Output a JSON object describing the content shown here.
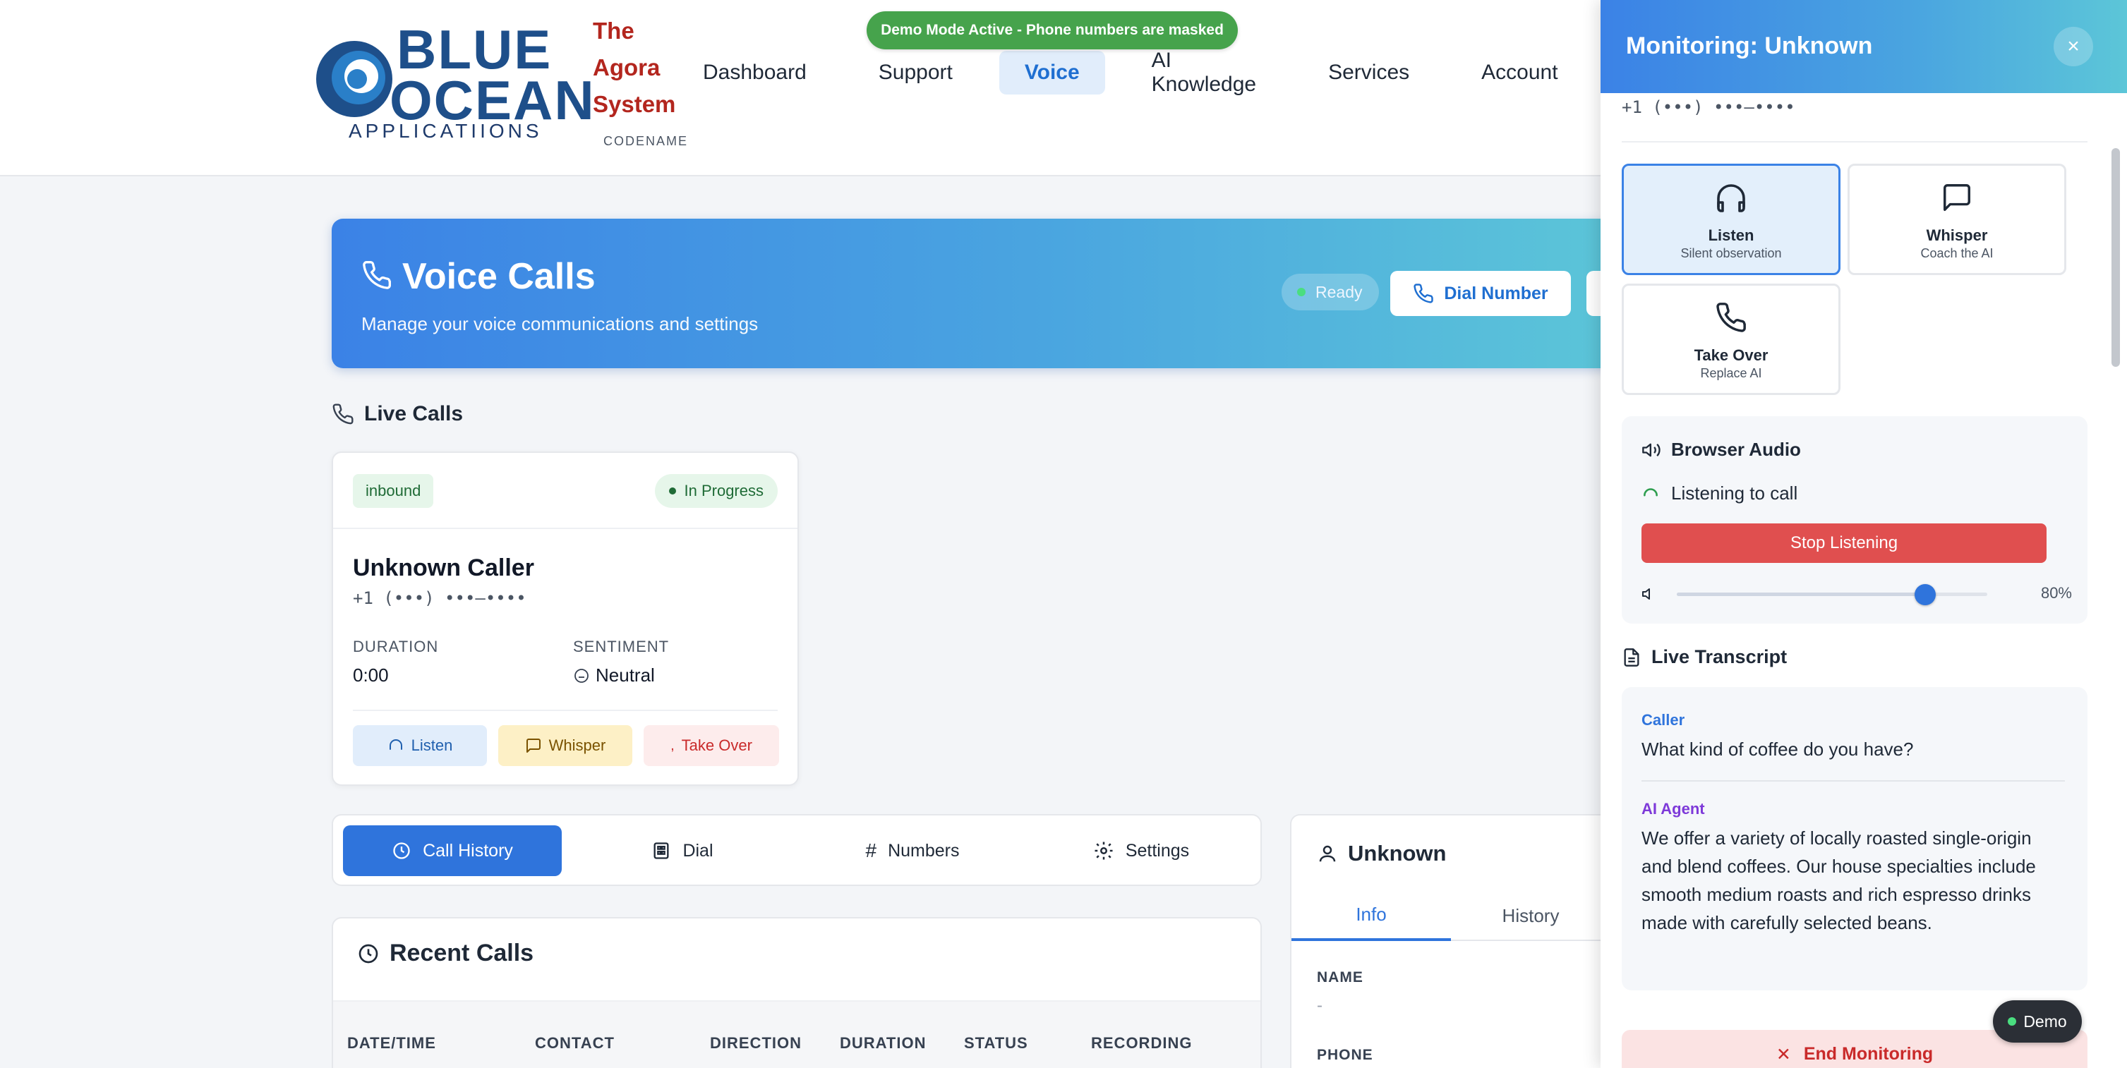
{
  "demo_banner": "Demo Mode Active - Phone numbers are masked",
  "logo": {
    "big": "BLUE\nOCEAN",
    "line1": "BLUE",
    "line2": "OCEAN",
    "sub": "APPLICATIIONS"
  },
  "agora": {
    "line1": "The",
    "line2": "Agora",
    "line3": "System",
    "codename": "CODENAME"
  },
  "nav": {
    "items": [
      "Dashboard",
      "Support",
      "Voice",
      "AI Knowledge",
      "Services",
      "Account"
    ],
    "active": "Voice"
  },
  "hero": {
    "title": "Voice Calls",
    "subtitle": "Manage your voice communications and settings",
    "status": "Ready",
    "dial_label": "Dial Number"
  },
  "live_calls": {
    "title": "Live Calls",
    "card": {
      "direction": "inbound",
      "status": "In Progress",
      "caller": "Unknown Caller",
      "phone": "+1 (•••) •••–••••",
      "duration_label": "DURATION",
      "duration": "0:00",
      "sentiment_label": "SENTIMENT",
      "sentiment": "Neutral",
      "listen": "Listen",
      "whisper": "Whisper",
      "takeover": "Take Over"
    }
  },
  "tabs": [
    "Call History",
    "Dial",
    "Numbers",
    "Settings"
  ],
  "recent": {
    "title": "Recent Calls",
    "columns": [
      "DATE/TIME",
      "CONTACT",
      "DIRECTION",
      "DURATION",
      "STATUS",
      "RECORDING"
    ]
  },
  "contact": {
    "title": "Unknown",
    "tabs": [
      "Info",
      "History"
    ],
    "name_label": "NAME",
    "name_value": "-",
    "phone_label": "PHONE"
  },
  "monitor": {
    "title": "Monitoring: Unknown",
    "phone": "+1 (•••) •••–••••",
    "modes": [
      {
        "name": "Listen",
        "sub": "Silent observation",
        "icon": "headphones-icon"
      },
      {
        "name": "Whisper",
        "sub": "Coach the AI",
        "icon": "message-icon"
      },
      {
        "name": "Take Over",
        "sub": "Replace AI",
        "icon": "phone-icon"
      }
    ],
    "audio_title": "Browser Audio",
    "audio_status": "Listening to call",
    "stop_label": "Stop Listening",
    "volume_pct": "80%",
    "volume_level": 0.8,
    "transcript_title": "Live Transcript",
    "transcript": [
      {
        "speaker": "Caller",
        "text": "What kind of coffee do you have?"
      },
      {
        "speaker": "AI Agent",
        "text": "We offer a variety of locally roasted single-origin and blend coffees. Our house specialties include smooth medium roasts and rich espresso drinks made with carefully selected beans."
      }
    ],
    "end_label": "End Monitoring"
  },
  "demo_chip": "Demo",
  "colors": {
    "primary": "#2f74dc",
    "danger": "#e04f4f",
    "success": "#46a34c",
    "brand_red": "#b3261e"
  }
}
